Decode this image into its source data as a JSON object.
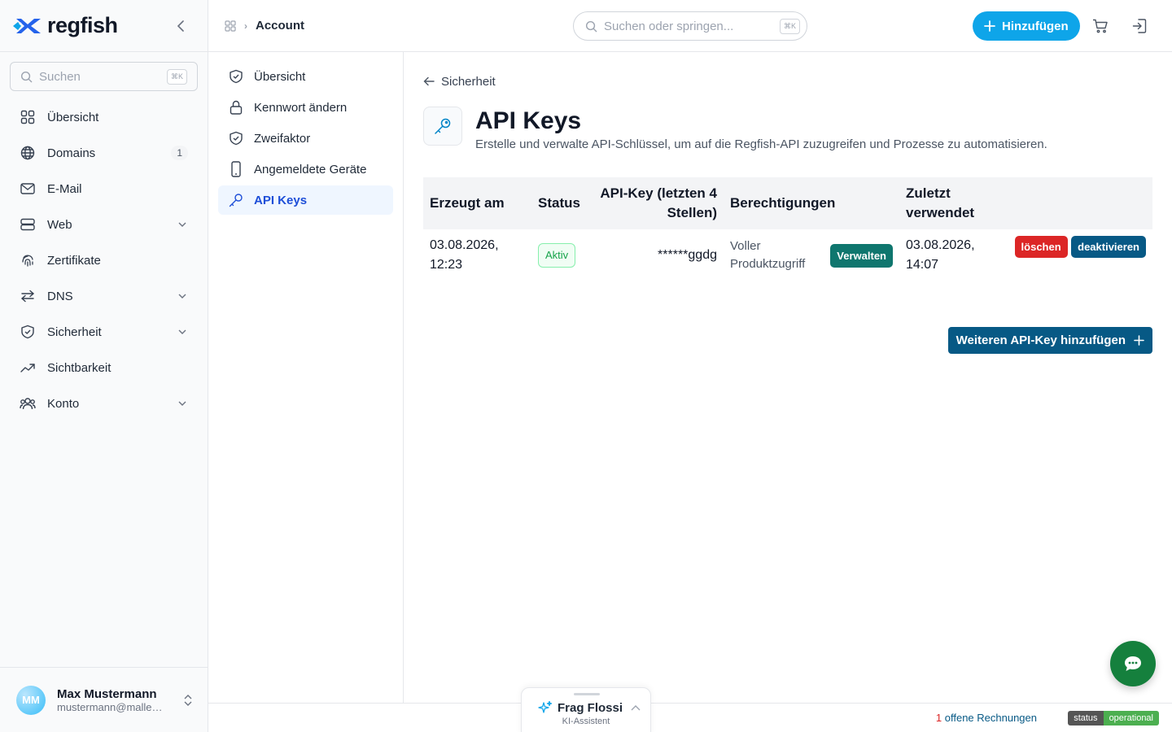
{
  "brand": {
    "name": "regfish",
    "accent": "#0ea5e9",
    "logo_blue": "#2563eb"
  },
  "sidebar": {
    "search_placeholder": "Suchen",
    "search_shortcut": "⌘K",
    "items": [
      {
        "label": "Übersicht",
        "icon": "grid-icon"
      },
      {
        "label": "Domains",
        "icon": "globe-icon",
        "badge": "1"
      },
      {
        "label": "E-Mail",
        "icon": "mail-icon"
      },
      {
        "label": "Web",
        "icon": "server-icon"
      },
      {
        "label": "Zertifikate",
        "icon": "fingerprint-icon"
      },
      {
        "label": "DNS",
        "icon": "arrows-swap-icon"
      },
      {
        "label": "Sicherheit",
        "icon": "shield-icon"
      },
      {
        "label": "Sichtbarkeit",
        "icon": "trend-icon"
      },
      {
        "label": "Konto",
        "icon": "users-icon"
      }
    ],
    "user": {
      "initials": "MM",
      "name": "Max Mustermann",
      "email": "mustermann@mallek...."
    }
  },
  "topbar": {
    "breadcrumb": "Account",
    "search_placeholder": "Suchen oder springen...",
    "search_shortcut": "⌘K",
    "add_label": "Hinzufügen"
  },
  "subnav": {
    "items": [
      {
        "label": "Übersicht",
        "icon": "shield-check-icon"
      },
      {
        "label": "Kennwort ändern",
        "icon": "lock-icon"
      },
      {
        "label": "Zweifaktor",
        "icon": "shield-check-icon"
      },
      {
        "label": "Angemeldete Geräte",
        "icon": "phone-icon"
      },
      {
        "label": "API Keys",
        "icon": "key-icon",
        "active": true
      }
    ]
  },
  "main": {
    "back_label": "Sicherheit",
    "title": "API Keys",
    "description": "Erstelle und verwalte API-Schlüssel, um auf die Regfish-API zuzugreifen und Prozesse zu automatisieren.",
    "table": {
      "headers": [
        "Erzeugt am",
        "Status",
        "API-Key (letzten 4 Stellen)",
        "Berechtigungen",
        "Zuletzt verwendet"
      ],
      "rows": [
        {
          "created": "03.08.2026, 12:23",
          "status": "Aktiv",
          "key": "******ggdg",
          "permissions": "Voller Produktzugriff",
          "manage": "Verwalten",
          "last_used": "03.08.2026, 14:07",
          "delete": "löschen",
          "deactivate": "deaktivieren"
        }
      ]
    },
    "add_more_label": "Weiteren API-Key hinzufügen"
  },
  "footer": {
    "invoices_count": "1",
    "invoices_text": "offene Rechnungen",
    "status_left": "status",
    "status_right": "operational"
  },
  "ai_assistant": {
    "title": "Frag Flossi",
    "subtitle": "KI-Assistent"
  }
}
